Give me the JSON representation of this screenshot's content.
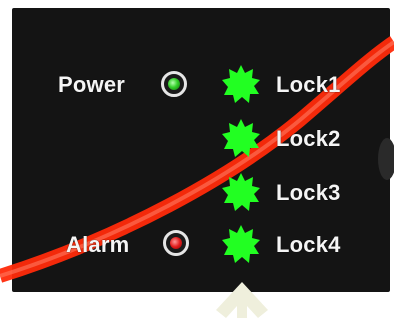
{
  "indicators": {
    "left": [
      {
        "label": "Power",
        "state": "on",
        "color": "#34d12a"
      },
      {
        "label": "Alarm",
        "state": "on",
        "color": "#e21b1b"
      }
    ],
    "locks": [
      {
        "label": "Lock1",
        "state": "lit",
        "color": "#22ff22"
      },
      {
        "label": "Lock2",
        "state": "lit",
        "color": "#22ff22"
      },
      {
        "label": "Lock3",
        "state": "lit",
        "color": "#22ff22"
      },
      {
        "label": "Lock4",
        "state": "lit",
        "color": "#22ff22"
      }
    ]
  },
  "colors": {
    "panel": "#141414",
    "stripe": "#ff2a0a",
    "label_text": "#f5f5f5",
    "arrow": "#efefdc"
  },
  "icons": {
    "lock_led": "starburst-led-icon",
    "status_led": "ring-led-icon",
    "pointer": "up-arrow-icon"
  }
}
